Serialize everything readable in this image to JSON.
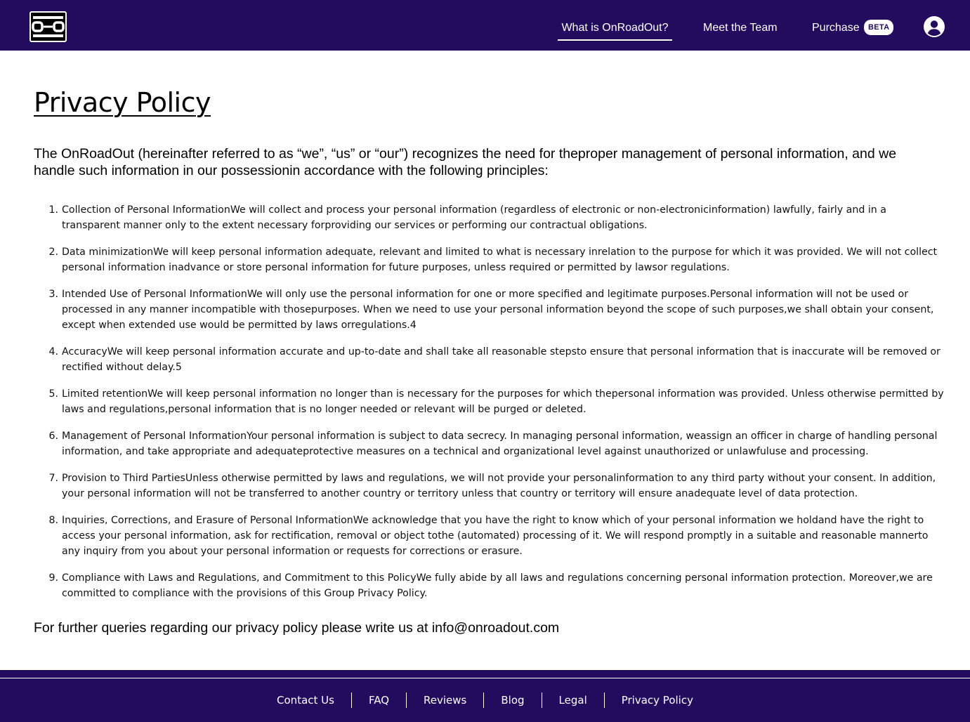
{
  "header": {
    "logo_icon": "onroadout-logo-icon",
    "nav": {
      "what": "What is OnRoadOut?",
      "team": "Meet the Team",
      "purchase": "Purchase",
      "beta_badge": "BETA"
    },
    "account_icon": "account-circle-icon"
  },
  "main": {
    "title": "Privacy Policy",
    "intro": "The OnRoadOut (hereinafter referred to as “we”, “us” or “our”) recognizes the need for theproper management of personal information, and we handle such information in our possessionin accordance with the following principles:",
    "items": [
      {
        "num": "1.",
        "text": "Collection of Personal InformationWe will collect and process your personal information (regardless of electronic or non-electronicinformation) lawfully, fairly and in a transparent manner only to the extent necessary forproviding our services or performing our contractual obligations."
      },
      {
        "num": "2.",
        "text": "Data minimizationWe will keep personal information adequate, relevant and limited to what is necessary inrelation to the purpose for which it was provided. We will not collect personal information inadvance or store personal information for future purposes, unless required or permitted by lawsor regulations."
      },
      {
        "num": "3.",
        "text": "Intended Use of Personal InformationWe will only use the personal information for one or more specified and legitimate purposes.Personal information will not be used or processed in any manner incompatible with thosepurposes. When we need to use your personal information beyond the scope of such purposes,we shall obtain your consent, except when extended use would be permitted by laws orregulations.4"
      },
      {
        "num": "4.",
        "text": "AccuracyWe will keep personal information accurate and up-to-date and shall take all reasonable stepsto ensure that personal information that is inaccurate will be removed or rectified without delay.5"
      },
      {
        "num": "5.",
        "text": "Limited retentionWe will keep personal information no longer than is necessary for the purposes for which thepersonal information was provided. Unless otherwise permitted by laws and regulations,personal information that is no longer needed or relevant will be purged or deleted."
      },
      {
        "num": "6.",
        "text": "Management of Personal InformationYour personal information is subject to data secrecy. In managing personal information, weassign an officer in charge of handling personal information, and take appropriate and adequateprotective measures on a technical and organizational level against unauthorized or unlawfuluse and processing."
      },
      {
        "num": "7.",
        "text": "Provision to Third PartiesUnless otherwise permitted by laws and regulations, we will not provide your personalinformation to any third party without your consent. In addition, your personal information will not be transferred to another country or territory unless that country or territory will ensure anadequate level of data protection."
      },
      {
        "num": "8.",
        "text": "Inquiries, Corrections, and Erasure of Personal InformationWe acknowledge that you have the right to know which of your personal information we holdand have the right to access your personal information, ask for rectification, removal or object tothe (automated) processing of it. We will respond promptly in a suitable and reasonable mannerto any inquiry from you about your personal information or requests for corrections or erasure."
      },
      {
        "num": "9.",
        "text": "Compliance with Laws and Regulations, and Commitment to this PolicyWe fully abide by all laws and regulations concerning personal information protection. Moreover,we are committed to compliance with the provisions of this Group Privacy Policy."
      }
    ],
    "outro": "For further queries regarding our privacy policy please write us at info@onroadout.com"
  },
  "footer": {
    "links": [
      "Contact Us",
      "FAQ",
      "Reviews",
      "Blog",
      "Legal",
      "Privacy Policy"
    ]
  },
  "colors": {
    "brand": "#230b5e",
    "on_brand": "#ffffff"
  }
}
